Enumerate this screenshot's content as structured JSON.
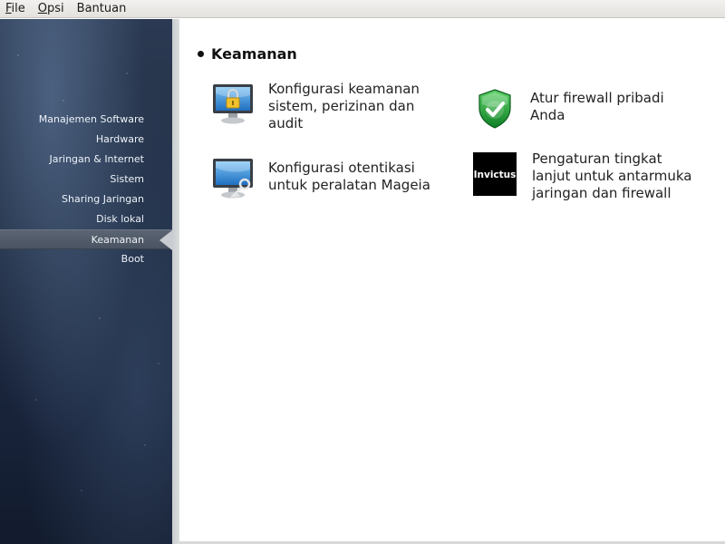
{
  "menubar": {
    "items": [
      {
        "mnemonic": "F",
        "rest": "ile"
      },
      {
        "mnemonic": "O",
        "rest": "psi"
      },
      {
        "mnemonic": "",
        "rest": "Bantuan"
      }
    ]
  },
  "sidebar": {
    "items": [
      {
        "label": "Manajemen Software"
      },
      {
        "label": "Hardware"
      },
      {
        "label": "Jaringan & Internet"
      },
      {
        "label": "Sistem"
      },
      {
        "label": "Sharing Jaringan"
      },
      {
        "label": "Disk lokal"
      },
      {
        "label": "Keamanan",
        "active": true
      },
      {
        "label": "Boot"
      }
    ]
  },
  "main": {
    "section_title": "Keamanan",
    "tools": [
      {
        "label": "Konfigurasi keamanan sistem, perizinan dan audit",
        "icon": "monitor-lock-icon"
      },
      {
        "label": "Atur firewall pribadi Anda",
        "icon": "shield-check-icon"
      },
      {
        "label": "Konfigurasi otentikasi untuk peralatan Mageia",
        "icon": "monitor-key-icon"
      },
      {
        "label": "Pengaturan tingkat lanjut untuk antarmuka jaringan dan firewall",
        "icon": "invictus-logo-icon",
        "icon_text": "Invictus"
      }
    ]
  },
  "colors": {
    "sidebar_bg": "#1f2c42",
    "active_item": "#4a5362",
    "shield_green": "#1fa336"
  }
}
